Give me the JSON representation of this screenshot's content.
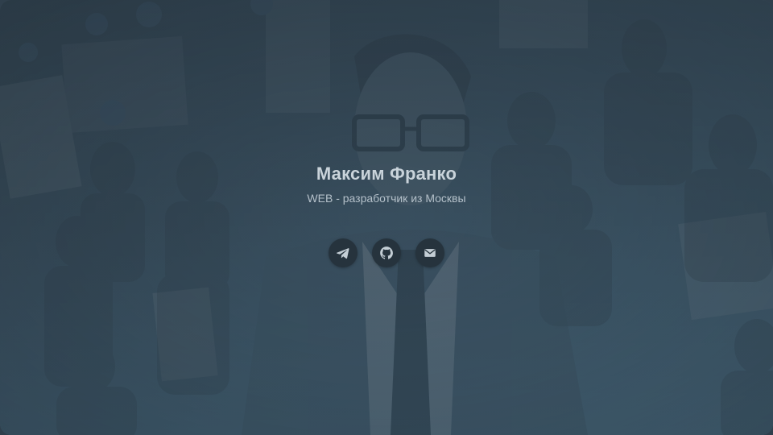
{
  "profile": {
    "name": "Максим Франко",
    "subtitle": "WEB - разработчик из Москвы"
  },
  "socials": [
    {
      "icon": "telegram-icon"
    },
    {
      "icon": "github-icon"
    },
    {
      "icon": "mail-icon"
    }
  ],
  "colors": {
    "icon_button_bg": "#26333d",
    "icon_fill": "#c4ced5",
    "name_text": "#c9d3da",
    "subtitle_text": "#b4c0c9"
  }
}
